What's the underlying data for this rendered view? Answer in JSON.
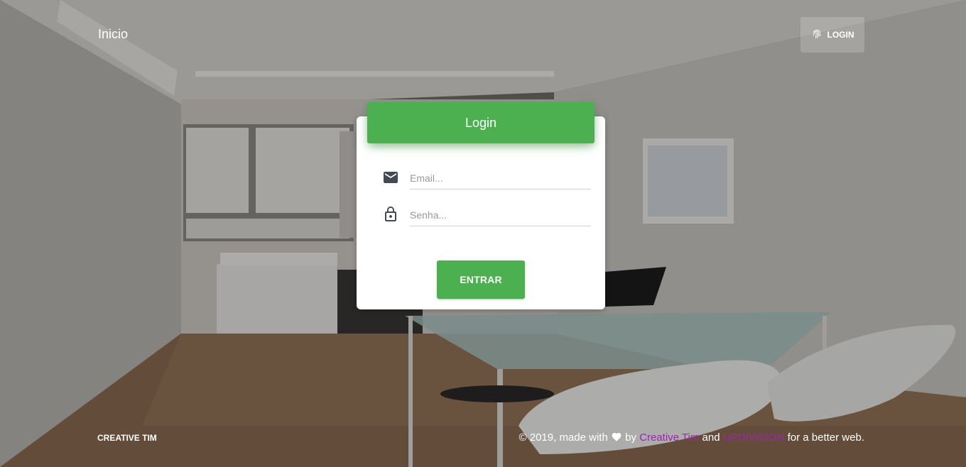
{
  "navbar": {
    "brand": "Inicio",
    "login_label": "LOGIN",
    "login_icon": "fingerprint-icon"
  },
  "card": {
    "title": "Login",
    "email": {
      "placeholder": "Email...",
      "value": "",
      "icon": "mail-icon"
    },
    "password": {
      "placeholder": "Senha...",
      "value": "",
      "icon": "lock-icon"
    },
    "submit_label": "ENTRAR"
  },
  "footer": {
    "left": "CREATIVE TIM",
    "copyright_prefix": "© 2019, made with",
    "heart_icon": "heart-icon",
    "by": "by",
    "link1": "Creative Tim",
    "and": "and",
    "link2": "UPDIVISION",
    "suffix": "for a better web."
  },
  "colors": {
    "primary": "#4caf50",
    "link": "#9c27b0",
    "text_light": "#ffffff"
  }
}
